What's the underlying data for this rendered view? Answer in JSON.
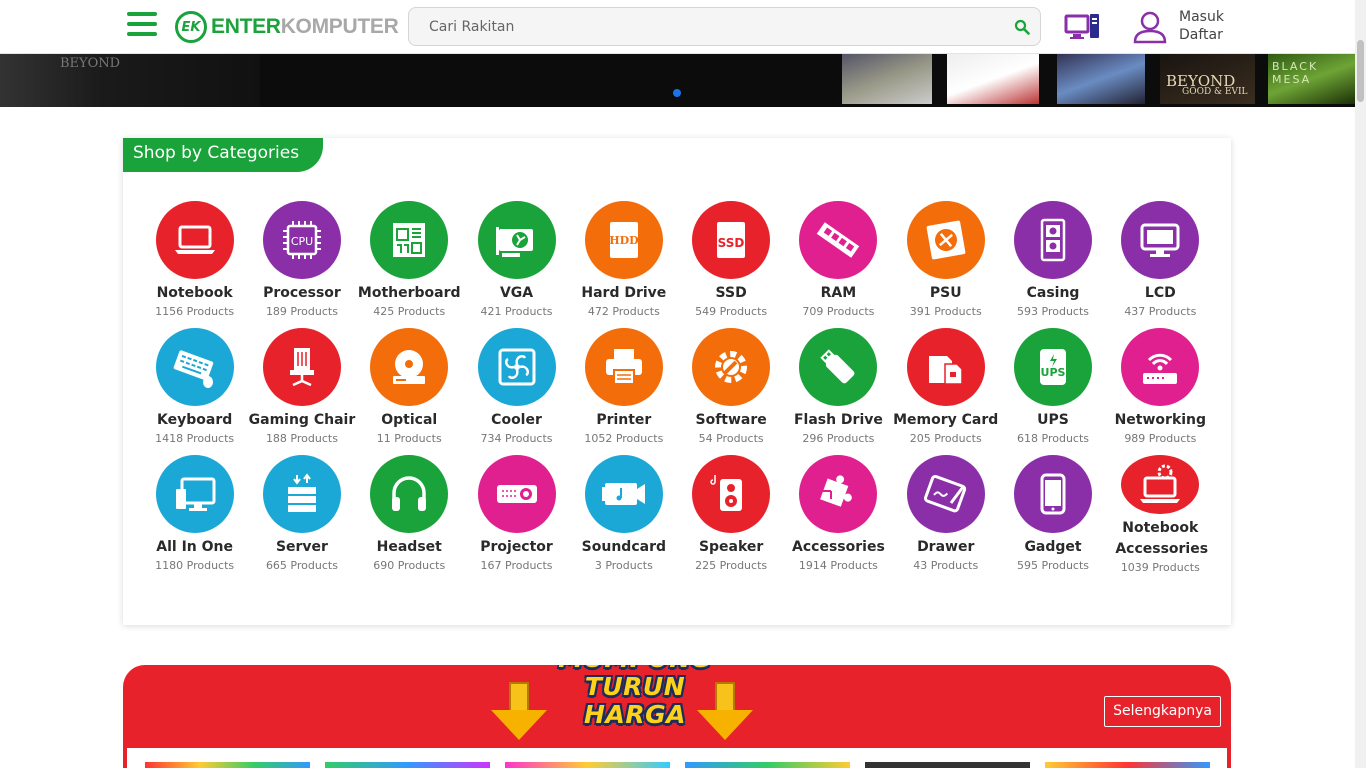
{
  "header": {
    "logo_part1": "ENTER",
    "logo_part2": "KOMPUTER",
    "logo_mark": "EK",
    "search_placeholder": "Cari Rakitan",
    "login": "Masuk",
    "register": "Daftar",
    "brand_green": "#1aa33a",
    "accent_purple": "#8b2fa8"
  },
  "banner": {
    "left_text": "BEYOND",
    "left_sub": "GOOD & EVIL",
    "right_title": "BEYOND",
    "right_sub": "GOOD & EVIL",
    "mesa": "BLACK MESA"
  },
  "categories": {
    "title": "Shop by Categories",
    "items": [
      {
        "name": "Notebook",
        "count": "1156 Products",
        "color": "#e8222b",
        "icon": "laptop-icon"
      },
      {
        "name": "Processor",
        "count": "189 Products",
        "color": "#8b2fa8",
        "icon": "cpu-icon"
      },
      {
        "name": "Motherboard",
        "count": "425 Products",
        "color": "#1aa33a",
        "icon": "motherboard-icon"
      },
      {
        "name": "VGA",
        "count": "421 Products",
        "color": "#1aa33a",
        "icon": "graphics-card-icon"
      },
      {
        "name": "Hard Drive",
        "count": "472 Products",
        "color": "#f36d0a",
        "icon": "hdd-icon"
      },
      {
        "name": "SSD",
        "count": "549 Products",
        "color": "#e8222b",
        "icon": "ssd-icon"
      },
      {
        "name": "RAM",
        "count": "709 Products",
        "color": "#e0208f",
        "icon": "ram-icon"
      },
      {
        "name": "PSU",
        "count": "391 Products",
        "color": "#f36d0a",
        "icon": "psu-icon"
      },
      {
        "name": "Casing",
        "count": "593 Products",
        "color": "#8b2fa8",
        "icon": "pc-case-icon"
      },
      {
        "name": "LCD",
        "count": "437 Products",
        "color": "#8b2fa8",
        "icon": "monitor-icon"
      },
      {
        "name": "Keyboard",
        "count": "1418 Products",
        "color": "#1ba8d6",
        "icon": "keyboard-icon"
      },
      {
        "name": "Gaming Chair",
        "count": "188 Products",
        "color": "#e8222b",
        "icon": "gaming-chair-icon"
      },
      {
        "name": "Optical",
        "count": "11 Products",
        "color": "#f36d0a",
        "icon": "optical-drive-icon"
      },
      {
        "name": "Cooler",
        "count": "734 Products",
        "color": "#1ba8d6",
        "icon": "fan-icon"
      },
      {
        "name": "Printer",
        "count": "1052 Products",
        "color": "#f36d0a",
        "icon": "printer-icon"
      },
      {
        "name": "Software",
        "count": "54 Products",
        "color": "#f36d0a",
        "icon": "gear-wrench-icon"
      },
      {
        "name": "Flash Drive",
        "count": "296 Products",
        "color": "#1aa33a",
        "icon": "usb-drive-icon"
      },
      {
        "name": "Memory Card",
        "count": "205 Products",
        "color": "#e8222b",
        "icon": "memory-card-icon"
      },
      {
        "name": "UPS",
        "count": "618 Products",
        "color": "#1aa33a",
        "icon": "ups-icon"
      },
      {
        "name": "Networking",
        "count": "989 Products",
        "color": "#e0208f",
        "icon": "router-icon"
      },
      {
        "name": "All In One",
        "count": "1180 Products",
        "color": "#1ba8d6",
        "icon": "all-in-one-icon"
      },
      {
        "name": "Server",
        "count": "665 Products",
        "color": "#1ba8d6",
        "icon": "server-icon"
      },
      {
        "name": "Headset",
        "count": "690 Products",
        "color": "#1aa33a",
        "icon": "headset-icon"
      },
      {
        "name": "Projector",
        "count": "167 Products",
        "color": "#e0208f",
        "icon": "projector-icon"
      },
      {
        "name": "Soundcard",
        "count": "3 Products",
        "color": "#1ba8d6",
        "icon": "soundcard-icon"
      },
      {
        "name": "Speaker",
        "count": "225 Products",
        "color": "#e8222b",
        "icon": "speaker-icon"
      },
      {
        "name": "Accessories",
        "count": "1914 Products",
        "color": "#e0208f",
        "icon": "puzzle-icon"
      },
      {
        "name": "Drawer",
        "count": "43 Products",
        "color": "#8b2fa8",
        "icon": "drawing-tablet-icon"
      },
      {
        "name": "Gadget",
        "count": "595 Products",
        "color": "#8b2fa8",
        "icon": "smartphone-icon"
      },
      {
        "name": "Notebook Accessories",
        "count": "1039 Products",
        "color": "#e8222b",
        "icon": "laptop-gear-icon"
      }
    ]
  },
  "promo": {
    "line1": "MUMPUNG",
    "line2": "TURUN",
    "line3": "HARGA",
    "more": "Selengkapnya",
    "bg_color": "#e8222b"
  }
}
